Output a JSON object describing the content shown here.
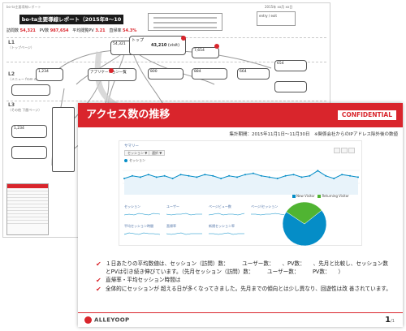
{
  "back_sheet": {
    "caption": "bo-ta主要導線レポート",
    "title": "bo-ta主要導線レポート（2015年8～10月度）",
    "stats": [
      {
        "label": "訪問数",
        "value": "54,321"
      },
      {
        "label": "PV数",
        "value": "987,654"
      },
      {
        "label": "平均閲覧PV",
        "value": "3.21"
      },
      {
        "label": "直帰率",
        "value": "54.3%"
      }
    ],
    "meta": "2015年 xx月 xx日",
    "meta_box": "entry / exit",
    "levels": [
      {
        "name": "L1",
        "sub": "（トップページ）"
      },
      {
        "name": "L2",
        "sub": "（メニュー from の遷移先ページ）"
      },
      {
        "name": "L3",
        "sub": "（その他 下層ページ）"
      }
    ],
    "nodes": {
      "top_count": "54,321",
      "top_label": "トップ",
      "top_total": "43,210",
      "top_unit": "(visit)",
      "right_count": "7,654",
      "a1": "1,234",
      "a2": "アプリケーション一覧",
      "n1": "800",
      "n2": "884",
      "n3": "664",
      "n4": "654",
      "n5": "1,234"
    }
  },
  "slide": {
    "title": "アクセス数の推移",
    "badge": "CONFIDENTIAL",
    "period": "集計期間：2015年11月1日～11月30日　※関係会社からのIPアドレス除外後の数値",
    "ga": {
      "tab_label": "サマリー",
      "dropdown": "セッション ▼",
      "compare": "選択 ▼",
      "series_label": "セッション",
      "metrics": [
        "セッション",
        "ユーザー",
        "ページビュー数",
        "ページ/セッション",
        "平均セッション時間",
        "直帰率",
        "新規セッション率"
      ],
      "pie_legend": [
        "New Visitor",
        "Returning Visitor"
      ]
    },
    "bullets": [
      {
        "line1": "１日あたりの平均数値は、セッション（訪問）数：　　　ユーザー数：　　、PV数：　　、先月と比較し、セッション数",
        "line2": "とPVは引き続き伸びています。（先月セッション（訪問）数：　　　ユーザー数：　　　PV数：　　）"
      },
      {
        "line1": "直帰率・平均セッション時間は",
        "line2": ""
      },
      {
        "line1": "全体的にセッションが 超える日が多くなってきました。先月までの傾向とは少し異なり、回遊性は改 善されています。",
        "line2": ""
      }
    ],
    "logo": "ALLEYOOP",
    "page": "1",
    "page_total": "/1"
  },
  "chart_data": {
    "type": "line",
    "series": [
      {
        "values": [
          60,
          62,
          61,
          63,
          61,
          62,
          60,
          63,
          62,
          61,
          63,
          62,
          60,
          62,
          61,
          63,
          64,
          62,
          61,
          60,
          62,
          63,
          61,
          62,
          66,
          62,
          60,
          63,
          62,
          61
        ]
      }
    ],
    "pie": {
      "values": [
        70,
        30
      ]
    },
    "colors": {
      "accent": "#d9252c",
      "ga_blue": "#058dc7",
      "ga_green": "#50b432"
    }
  }
}
